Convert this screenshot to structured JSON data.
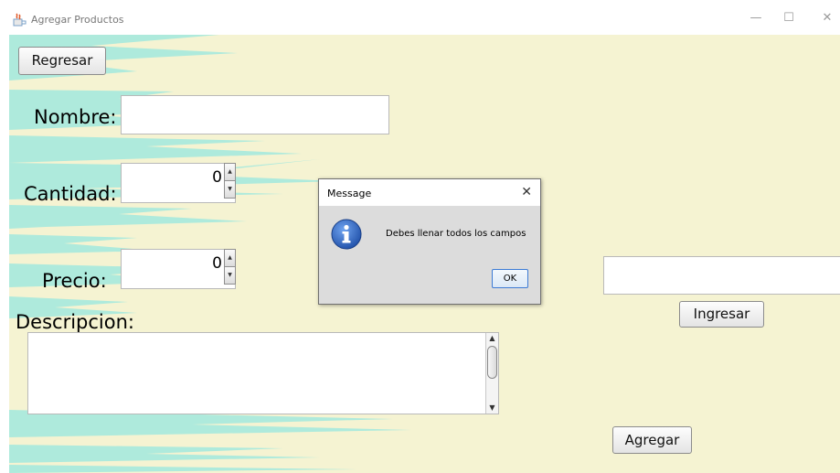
{
  "window": {
    "title": "Agregar Productos",
    "controls": {
      "minimize": "—",
      "maximize": "☐",
      "close": "✕"
    }
  },
  "form": {
    "back_button": "Regresar",
    "nombre_label": "Nombre:",
    "nombre_value": "",
    "cantidad_label": "Cantidad:",
    "cantidad_value": "0",
    "precio_label": "Precio:",
    "precio_value": "0",
    "descripcion_label": "Descripcion:",
    "descripcion_value": "",
    "side_field_value": "",
    "ingresar_button": "Ingresar",
    "agregar_button": "Agregar"
  },
  "dialog": {
    "title": "Message",
    "close": "✕",
    "icon": "info-icon",
    "message": "Debes llenar todos los campos",
    "ok_button": "OK"
  },
  "colors": {
    "background": "#f5f3d2",
    "stripes": "#aeeadc",
    "dialog_icon": "#2f66c2"
  },
  "icons": {
    "spinner_up": "▲",
    "spinner_down": "▼",
    "scroll_up": "▲",
    "scroll_down": "▼"
  }
}
